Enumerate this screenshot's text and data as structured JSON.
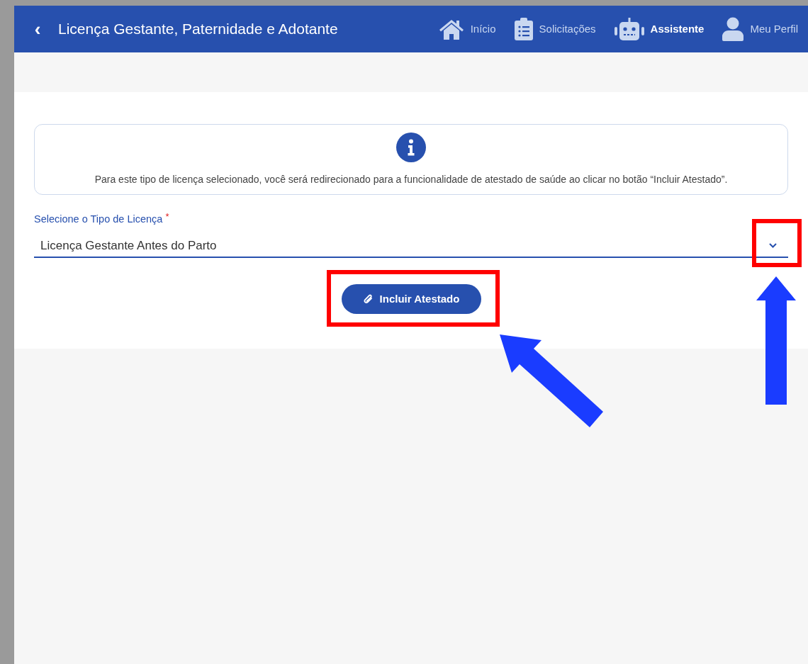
{
  "header": {
    "back": "‹",
    "title": "Licença Gestante, Paternidade e Adotante"
  },
  "nav": [
    {
      "kind": "home",
      "label": "Início",
      "selected": false
    },
    {
      "kind": "clipboard",
      "label": "Solicitações",
      "selected": false
    },
    {
      "kind": "robot",
      "label": "Assistente",
      "selected": true
    },
    {
      "kind": "user",
      "label": "Meu Perfil",
      "selected": false
    }
  ],
  "info": {
    "message": "Para este tipo de licença selecionado, você será redirecionado para a funcionalidade de atestado de saúde ao clicar no botão “Incluir Atestado”."
  },
  "select": {
    "label": "Selecione o Tipo de Licença",
    "required_mark": "*",
    "value": "Licença Gestante Antes do Parto"
  },
  "button": {
    "label": "Incluir Atestado"
  }
}
